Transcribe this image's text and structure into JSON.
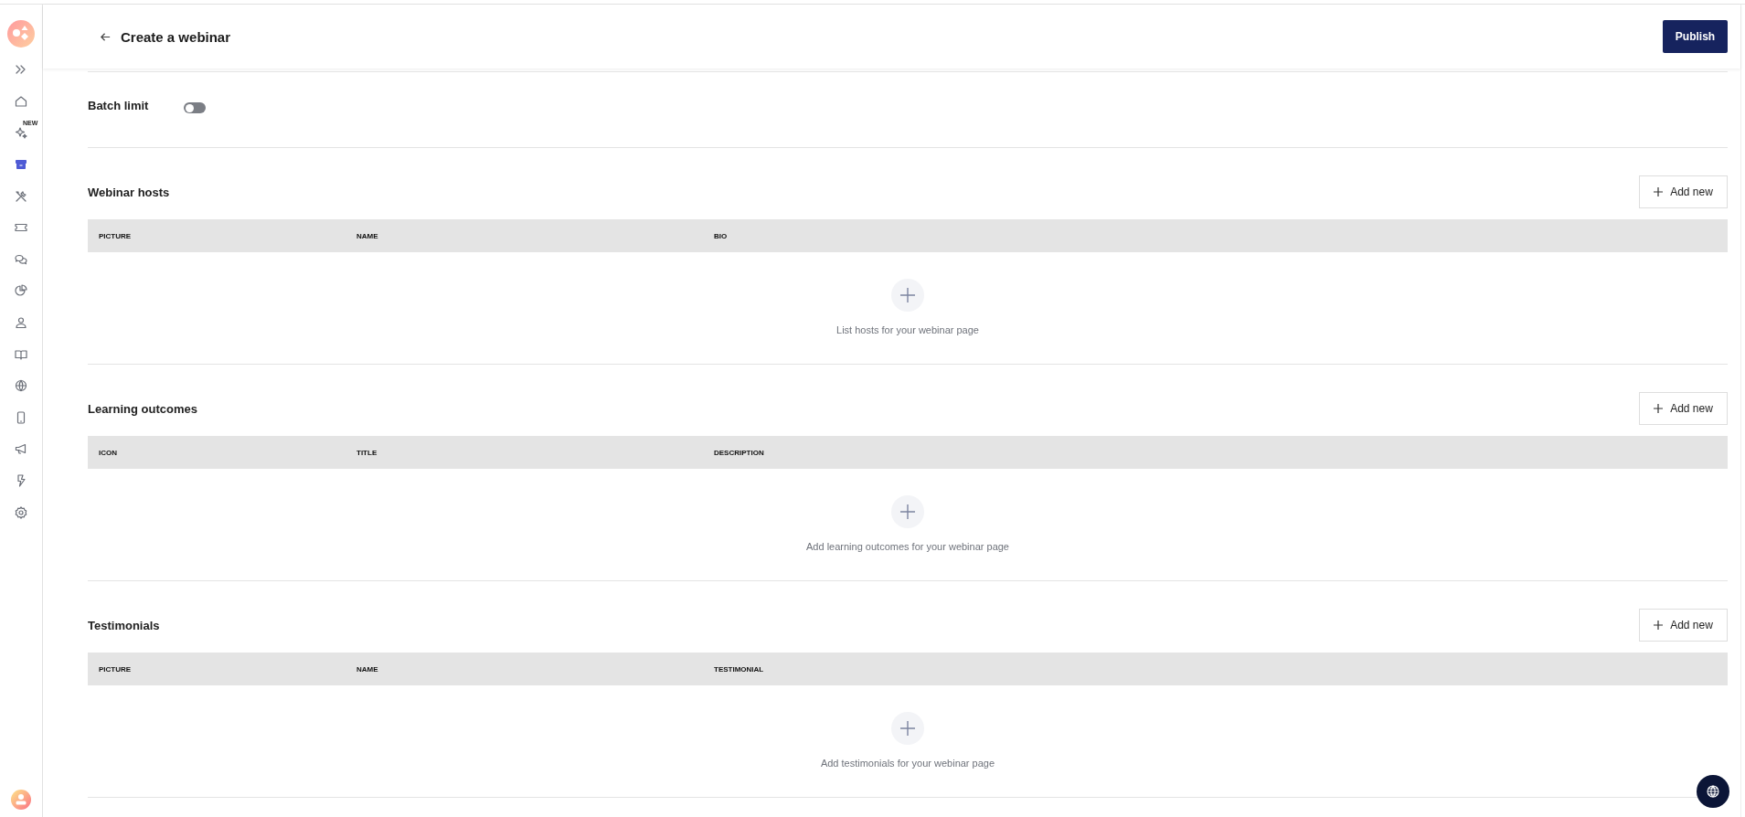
{
  "sidebar": {
    "items": [
      {
        "selected": false
      },
      {
        "selected": false
      },
      {
        "selected": false,
        "badge": "NEW"
      },
      {
        "selected": true
      },
      {
        "selected": false
      },
      {
        "selected": false
      },
      {
        "selected": false
      },
      {
        "selected": false
      },
      {
        "selected": false
      },
      {
        "selected": false
      },
      {
        "selected": false
      },
      {
        "selected": false
      },
      {
        "selected": false
      },
      {
        "selected": false
      },
      {
        "selected": false
      }
    ]
  },
  "header": {
    "title": "Create a webinar",
    "publish_button": "Publish"
  },
  "batch_limit": {
    "label": "Batch limit",
    "on": false
  },
  "sections": [
    {
      "title": "Webinar hosts",
      "button": "Add new",
      "columns": [
        "PICTURE",
        "NAME",
        "BIO"
      ],
      "empty_text": "List hosts for your webinar page"
    },
    {
      "title": "Learning outcomes",
      "button": "Add new",
      "columns": [
        "ICON",
        "TITLE",
        "DESCRIPTION"
      ],
      "empty_text": "Add learning outcomes for your webinar page"
    },
    {
      "title": "Testimonials",
      "button": "Add new",
      "columns": [
        "PICTURE",
        "NAME",
        "TESTIMONIAL"
      ],
      "empty_text": "Add testimonials for your webinar page"
    }
  ]
}
